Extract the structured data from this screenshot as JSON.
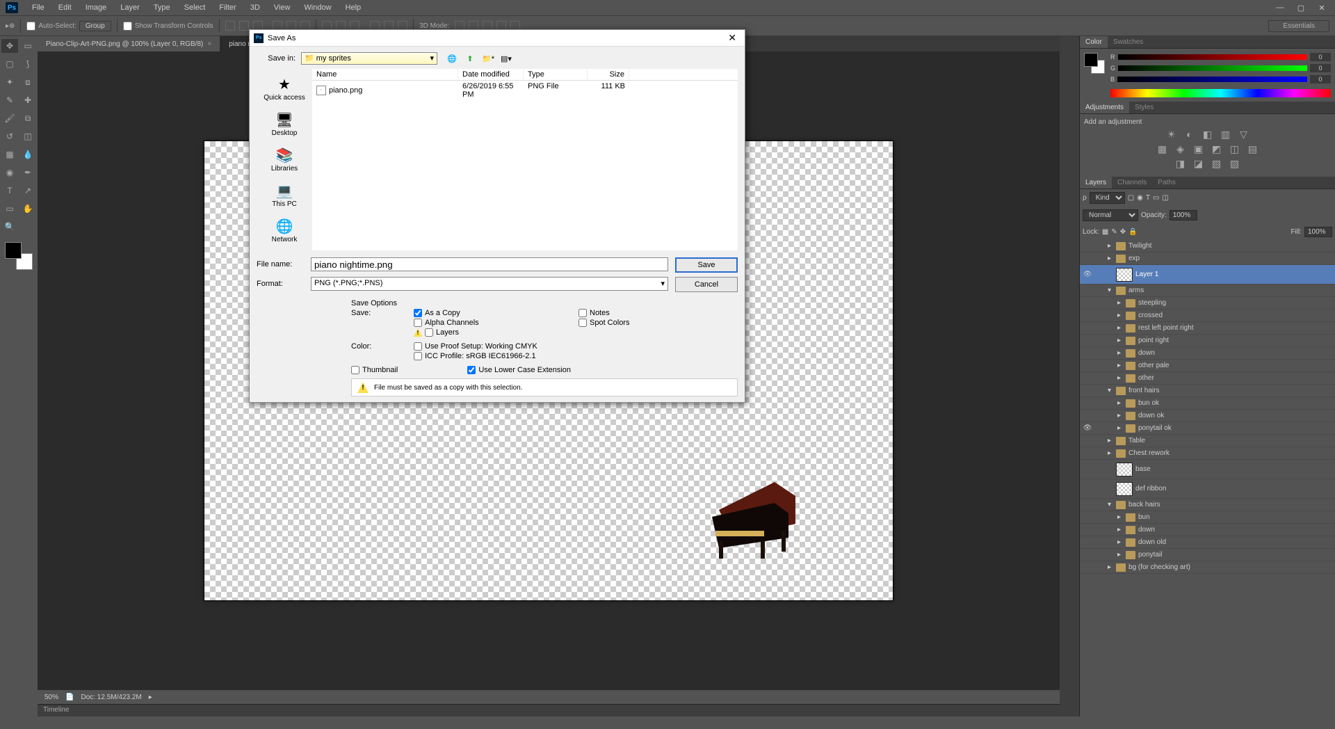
{
  "menu": [
    "File",
    "Edit",
    "Image",
    "Layer",
    "Type",
    "Select",
    "Filter",
    "3D",
    "View",
    "Window",
    "Help"
  ],
  "options": {
    "auto_select": "Auto-Select:",
    "auto_select_mode": "Group",
    "show_transform": "Show Transform Controls",
    "mode3d": "3D Mode:"
  },
  "workspace": "Essentials",
  "tabs": [
    {
      "label": "Piano-Clip-Art-PNG.png @ 100% (Layer 0, RGB/8)",
      "active": false
    },
    {
      "label": "piano nightime.p...",
      "active": true
    }
  ],
  "status": {
    "zoom": "50%",
    "doc": "Doc: 12.5M/423.2M"
  },
  "timeline": "Timeline",
  "panels": {
    "color": {
      "tab1": "Color",
      "tab2": "Swatches",
      "r": "0",
      "g": "0",
      "b": "0"
    },
    "adjustments": {
      "tab1": "Adjustments",
      "tab2": "Styles",
      "header": "Add an adjustment"
    },
    "layers": {
      "tab1": "Layers",
      "tab2": "Channels",
      "tab3": "Paths",
      "kind": "Kind",
      "blend": "Normal",
      "opacity_label": "Opacity:",
      "opacity": "100%",
      "lock": "Lock:",
      "fill_label": "Fill:",
      "fill": "100%"
    }
  },
  "layers": [
    {
      "name": "Twilight",
      "type": "group",
      "indent": 0,
      "expand": "▸",
      "vis": ""
    },
    {
      "name": "exp",
      "type": "group",
      "indent": 0,
      "expand": "▸",
      "vis": ""
    },
    {
      "name": "Layer 1",
      "type": "layer",
      "indent": 0,
      "vis": "👁",
      "selected": true
    },
    {
      "name": "arms",
      "type": "group",
      "indent": 0,
      "expand": "▾",
      "vis": ""
    },
    {
      "name": "steepling",
      "type": "group",
      "indent": 1,
      "expand": "▸",
      "vis": ""
    },
    {
      "name": "crossed",
      "type": "group",
      "indent": 1,
      "expand": "▸",
      "vis": ""
    },
    {
      "name": "rest left point right",
      "type": "group",
      "indent": 1,
      "expand": "▸",
      "vis": ""
    },
    {
      "name": "point right",
      "type": "group",
      "indent": 1,
      "expand": "▸",
      "vis": ""
    },
    {
      "name": "down",
      "type": "group",
      "indent": 1,
      "expand": "▸",
      "vis": ""
    },
    {
      "name": "other pale",
      "type": "group",
      "indent": 1,
      "expand": "▸",
      "vis": ""
    },
    {
      "name": "other",
      "type": "group",
      "indent": 1,
      "expand": "▸",
      "vis": ""
    },
    {
      "name": "front hairs",
      "type": "group",
      "indent": 0,
      "expand": "▾",
      "vis": ""
    },
    {
      "name": "bun ok",
      "type": "group",
      "indent": 1,
      "expand": "▸",
      "vis": ""
    },
    {
      "name": "down ok",
      "type": "group",
      "indent": 1,
      "expand": "▸",
      "vis": ""
    },
    {
      "name": "ponytail ok",
      "type": "group",
      "indent": 1,
      "expand": "▸",
      "vis": "👁"
    },
    {
      "name": "Table",
      "type": "group",
      "indent": 0,
      "expand": "▸",
      "vis": ""
    },
    {
      "name": "Chest rework",
      "type": "group",
      "indent": 0,
      "expand": "▸",
      "vis": ""
    },
    {
      "name": "base",
      "type": "layer",
      "indent": 0,
      "vis": ""
    },
    {
      "name": "def ribbon",
      "type": "layer",
      "indent": 0,
      "vis": ""
    },
    {
      "name": "back hairs",
      "type": "group",
      "indent": 0,
      "expand": "▾",
      "vis": ""
    },
    {
      "name": "bun",
      "type": "group",
      "indent": 1,
      "expand": "▸",
      "vis": ""
    },
    {
      "name": "down",
      "type": "group",
      "indent": 1,
      "expand": "▸",
      "vis": ""
    },
    {
      "name": "down old",
      "type": "group",
      "indent": 1,
      "expand": "▸",
      "vis": ""
    },
    {
      "name": "ponytail",
      "type": "group",
      "indent": 1,
      "expand": "▸",
      "vis": ""
    },
    {
      "name": "bg (for checking art)",
      "type": "group",
      "indent": 0,
      "expand": "▸",
      "vis": ""
    }
  ],
  "dialog": {
    "title": "Save As",
    "save_in_label": "Save in:",
    "save_in": "my sprites",
    "headers": {
      "name": "Name",
      "date": "Date modified",
      "type": "Type",
      "size": "Size"
    },
    "files": [
      {
        "name": "piano.png",
        "date": "6/26/2019 6:55 PM",
        "type": "PNG File",
        "size": "111 KB"
      }
    ],
    "sidebar": [
      {
        "label": "Quick access",
        "icon": "★"
      },
      {
        "label": "Desktop",
        "icon": "🖥"
      },
      {
        "label": "Libraries",
        "icon": "📚"
      },
      {
        "label": "This PC",
        "icon": "💻"
      },
      {
        "label": "Network",
        "icon": "🌐"
      }
    ],
    "filename_label": "File name:",
    "filename": "piano nightime.png",
    "format_label": "Format:",
    "format": "PNG (*.PNG;*.PNS)",
    "save_btn": "Save",
    "cancel_btn": "Cancel",
    "save_options": "Save Options",
    "save_label": "Save:",
    "as_copy": "As a Copy",
    "notes": "Notes",
    "alpha": "Alpha Channels",
    "spot": "Spot Colors",
    "layers_cb": "Layers",
    "color_label": "Color:",
    "proof": "Use Proof Setup:   Working CMYK",
    "icc": "ICC Profile:   sRGB IEC61966-2.1",
    "thumbnail": "Thumbnail",
    "lowercase": "Use Lower Case Extension",
    "warning": "File must be saved as a copy with this selection."
  }
}
